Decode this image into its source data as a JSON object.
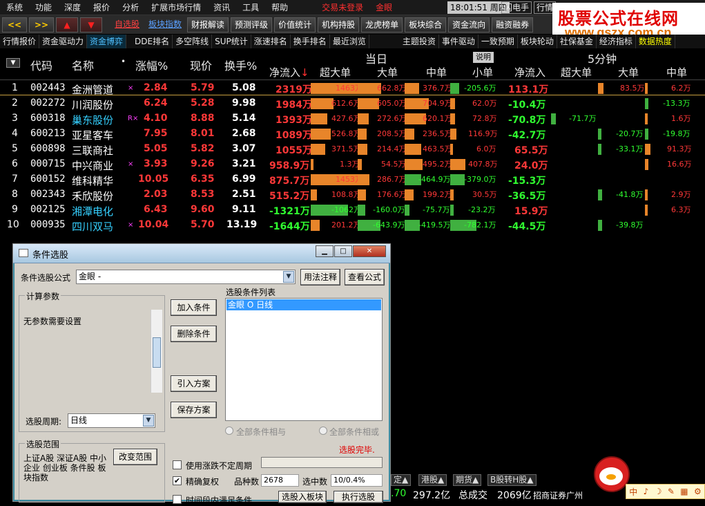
{
  "menu": {
    "items": [
      "系统",
      "功能",
      "深度",
      "报价",
      "分析",
      "扩展市场行情",
      "资讯",
      "工具",
      "帮助"
    ],
    "login_status": "交易未登录",
    "gold_eye": "金眼",
    "clock": "18:01:51",
    "weekday": "周四",
    "flash": "闪电手",
    "flash2": "行情"
  },
  "toolbar": {
    "back": "<<",
    "fwd": ">>",
    "up": "▲",
    "down": "▼",
    "self_select": "自选股",
    "sector_index": "板块指数",
    "buttons": [
      "财报解读",
      "预测评级",
      "价值统计",
      "机构持股",
      "龙虎榜单",
      "板块综合",
      "资金流向",
      "融资融券"
    ]
  },
  "logo": {
    "line1": "股票公式在线网",
    "line2": "www.gszx.com.cn"
  },
  "tabs": [
    "行情报价",
    "资金驱动力",
    "资金博弈",
    "DDE排名",
    "多空阵线",
    "SUP统计",
    "涨速排名",
    "换手排名",
    "最近浏览",
    "主题投资",
    "事件驱动",
    "一致预期",
    "板块轮动",
    "社保基金",
    "经济指标",
    "数据热度"
  ],
  "active_tab": "资金博弈",
  "table": {
    "headers": {
      "code": "代码",
      "name": "名称",
      "dot": "•",
      "change": "涨幅%",
      "price": "现价",
      "turnover": "换手%",
      "today": "当日",
      "explain": "说明",
      "five_min": "5分钟",
      "net_in": "净流入",
      "super_large": "超大单",
      "large": "大单",
      "medium": "中单",
      "small": "小单",
      "net_in2": "净流入",
      "super_large2": "超大单",
      "large2": "大单",
      "medium2": "中单"
    },
    "rows": [
      {
        "idx": "1",
        "code": "002443",
        "name": "金洲管道",
        "mark": "×",
        "chg": "2.84",
        "price": "5.79",
        "turn": "5.08",
        "net": "2319万",
        "sl": "1463万",
        "lg": "662.8万",
        "md": "376.7万",
        "sm": "-205.6万",
        "net5": "113.1万",
        "sl5": "",
        "lg5": "83.5万",
        "md5": "6.2万"
      },
      {
        "idx": "2",
        "code": "002272",
        "name": "川润股份",
        "mark": "",
        "chg": "6.24",
        "price": "5.28",
        "turn": "9.98",
        "net": "1984万",
        "sl": "612.6万",
        "lg": "605.0万",
        "md": "704.9万",
        "sm": "62.0万",
        "net5": "-10.4万",
        "sl5": "",
        "lg5": "",
        "md5": "-13.3万"
      },
      {
        "idx": "3",
        "code": "600318",
        "name": "巢东股份",
        "mark": "R×",
        "chg": "4.10",
        "price": "8.88",
        "turn": "5.14",
        "net": "1393万",
        "sl": "427.6万",
        "lg": "272.6万",
        "md": "620.1万",
        "sm": "72.8万",
        "net5": "-70.8万",
        "sl5": "-71.7万",
        "lg5": "",
        "md5": "1.6万"
      },
      {
        "idx": "4",
        "code": "600213",
        "name": "亚星客车",
        "mark": "",
        "chg": "7.95",
        "price": "8.01",
        "turn": "2.68",
        "net": "1089万",
        "sl": "526.8万",
        "lg": "208.5万",
        "md": "236.5万",
        "sm": "116.9万",
        "net5": "-42.7万",
        "sl5": "",
        "lg5": "-20.7万",
        "md5": "-19.8万"
      },
      {
        "idx": "5",
        "code": "600898",
        "name": "三联商社",
        "mark": "",
        "chg": "5.05",
        "price": "5.82",
        "turn": "3.07",
        "net": "1055万",
        "sl": "371.5万",
        "lg": "214.4万",
        "md": "463.5万",
        "sm": "6.0万",
        "net5": "65.5万",
        "sl5": "",
        "lg5": "-33.1万",
        "md5": "91.3万"
      },
      {
        "idx": "6",
        "code": "000715",
        "name": "中兴商业",
        "mark": "×",
        "chg": "3.93",
        "price": "9.26",
        "turn": "3.21",
        "net": "958.9万",
        "sl": "1.3万",
        "lg": "54.5万",
        "md": "495.2万",
        "sm": "407.8万",
        "net5": "24.0万",
        "sl5": "",
        "lg5": "",
        "md5": "16.6万"
      },
      {
        "idx": "7",
        "code": "600152",
        "name": "维科精华",
        "mark": "",
        "chg": "10.05",
        "price": "6.35",
        "turn": "6.99",
        "net": "875.7万",
        "sl": "1453万",
        "lg": "286.7万",
        "md": "-464.9万",
        "sm": "-379.0万",
        "net5": "-15.3万",
        "sl5": "",
        "lg5": "",
        "md5": ""
      },
      {
        "idx": "8",
        "code": "002343",
        "name": "禾欣股份",
        "mark": "",
        "chg": "2.03",
        "price": "8.53",
        "turn": "2.51",
        "net": "515.2万",
        "sl": "108.8万",
        "lg": "176.6万",
        "md": "199.2万",
        "sm": "30.5万",
        "net5": "-36.5万",
        "sl5": "",
        "lg5": "-41.8万",
        "md5": "2.9万"
      },
      {
        "idx": "9",
        "code": "002125",
        "name": "湘潭电化",
        "mark": "",
        "chg": "6.43",
        "price": "9.60",
        "turn": "9.11",
        "net": "-1321万",
        "sl": "-1062万",
        "lg": "-160.0万",
        "md": "-75.7万",
        "sm": "-23.2万",
        "net5": "15.9万",
        "sl5": "",
        "lg5": "",
        "md5": "6.3万"
      },
      {
        "idx": "10",
        "code": "000935",
        "name": "四川双马",
        "mark": "×",
        "chg": "10.04",
        "price": "5.70",
        "turn": "13.19",
        "net": "-1644万",
        "sl": "201.2万",
        "lg": "-643.9万",
        "md": "-419.5万",
        "sm": "-782.1万",
        "net5": "-44.5万",
        "sl5": "",
        "lg5": "-39.8万",
        "md5": ""
      }
    ]
  },
  "dialog": {
    "title": "条件选股",
    "formula_label": "条件选股公式",
    "formula_value": "金眼      -",
    "usage_btn": "用法注释",
    "view_btn": "查看公式",
    "calc_params": "计算参数",
    "no_params": "无参数需要设置",
    "add_btn": "加入条件",
    "del_btn": "删除条件",
    "import_btn": "引入方案",
    "save_btn": "保存方案",
    "list_title": "选股条件列表",
    "list_item": "金眼  O  日线",
    "period_label": "选股周期:",
    "period_value": "日线",
    "all_and": "全部条件相与",
    "all_or": "全部条件相或",
    "done": "选股完毕.",
    "range_title": "选股范围",
    "range_text": "上证A股 深证A股 中小企业 创业板 条件股 板块指数",
    "change_range": "改变范围",
    "uncertain": "使用涨跌不定周期",
    "exact": "精确复权",
    "exact_checked": "✔",
    "count_label": "品种数",
    "count_value": "2678",
    "selected_label": "选中数",
    "selected_value": "10/0.4%",
    "time_cond": "时间段内满足条件",
    "to_block": "选股入板块",
    "run": "执行选股"
  },
  "bottom": {
    "tabs": [
      "定▲",
      "港股▲",
      "期货▲",
      "B股转H股▲"
    ],
    "s1": ".70",
    "s2": "297.2亿",
    "s3": "总成交",
    "s4": "2069亿",
    "s5": "招商证券广州",
    "corner": [
      "中",
      "♪",
      "☽",
      "✎",
      "▦",
      "⚙"
    ]
  }
}
